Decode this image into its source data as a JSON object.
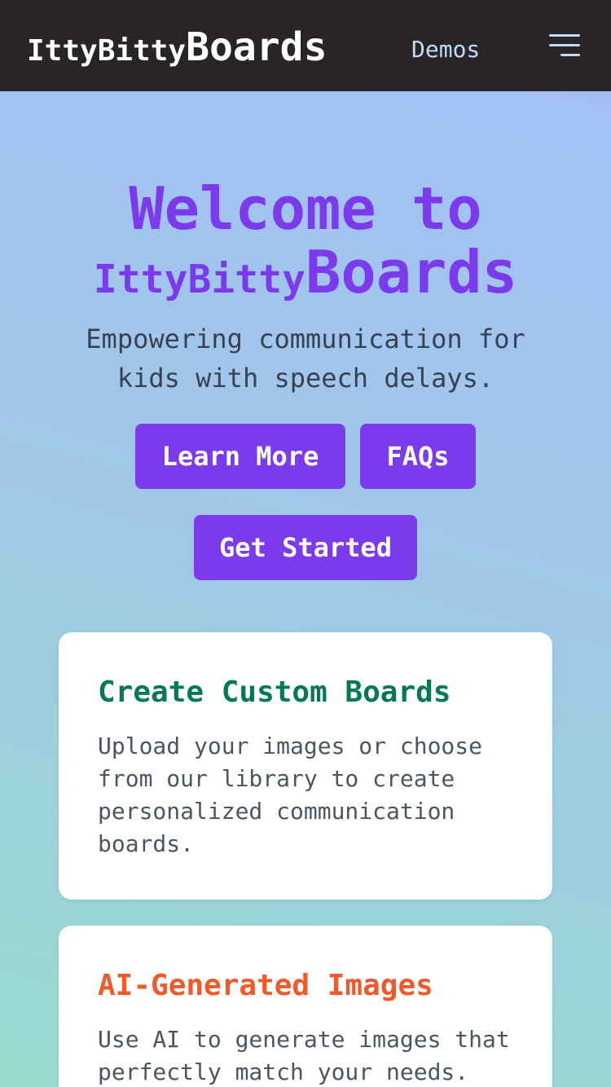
{
  "nav": {
    "brand_small": "IttyBitty",
    "brand_big": "Boards",
    "demos_label": "Demos"
  },
  "hero": {
    "line1": "Welcome to",
    "line2_small": "IttyBitty",
    "line2_big": "Boards",
    "subtitle": "Empowering communication for kids with speech delays."
  },
  "buttons": {
    "learn_more": "Learn More",
    "faqs": "FAQs",
    "get_started": "Get Started"
  },
  "features": [
    {
      "title": "Create Custom Boards",
      "text": "Upload your images or choose from our library to create personalized communication boards.",
      "color": "#047857"
    },
    {
      "title": "AI-Generated Images",
      "text": "Use AI to generate images that perfectly match your needs.",
      "color": "#f1592a"
    }
  ],
  "colors": {
    "accent": "#7c3aed",
    "navbar": "#282524"
  }
}
